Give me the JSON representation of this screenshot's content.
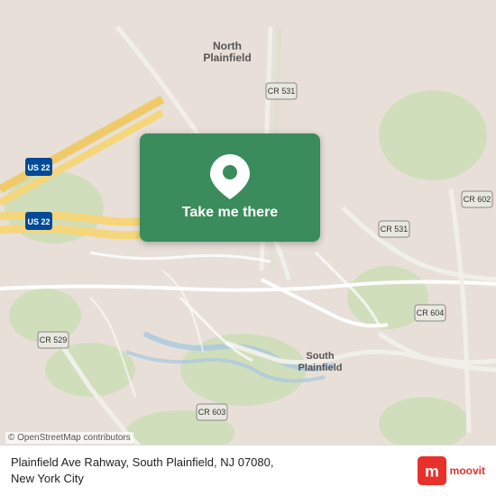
{
  "map": {
    "background_color": "#e8e0d8",
    "center_lat": 40.5732,
    "center_lon": -74.4198
  },
  "button": {
    "label": "Take me there",
    "background_color": "#3a8c5c"
  },
  "address": {
    "line1": "Plainfield Ave Rahway, South Plainfield, NJ 07080,",
    "line2": "New York City"
  },
  "attribution": {
    "text": "© OpenStreetMap contributors"
  },
  "moovit": {
    "label": "moovit"
  },
  "labels": {
    "north_plainfield": "North\nPlainfield",
    "south_plainfield": "South\nPlainfield",
    "us22_1": "US 22",
    "us22_2": "US 22",
    "cr531_1": "CR 531",
    "cr531_2": "CR 531",
    "cr529": "CR 529",
    "cr602": "CR 602",
    "cr603": "CR 603",
    "cr604": "CR 604"
  }
}
